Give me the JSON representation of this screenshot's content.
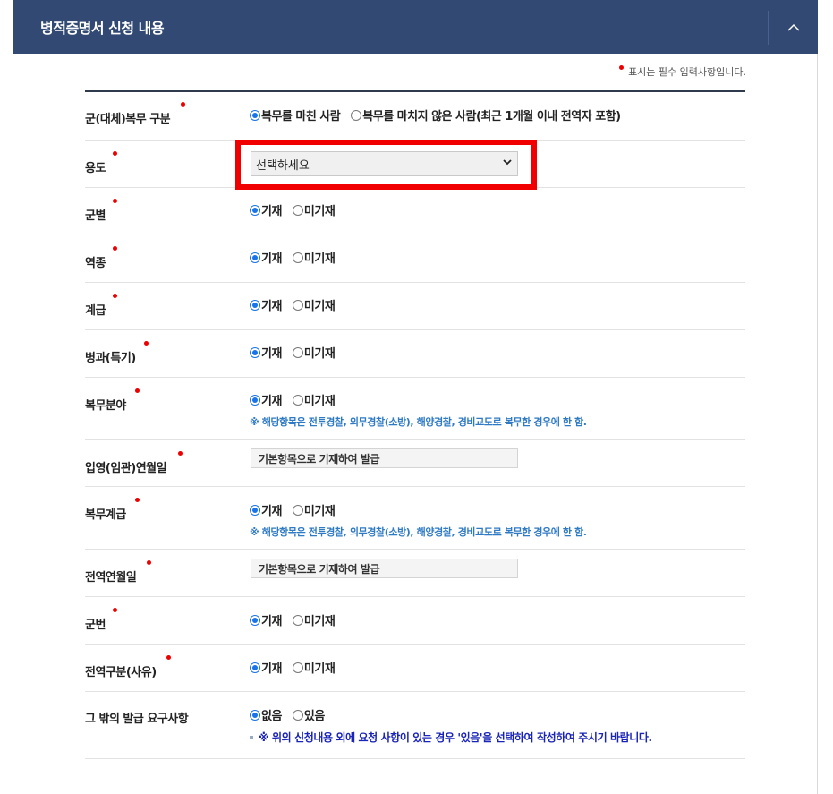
{
  "header": {
    "title": "병적증명서 신청 내용",
    "collapse_icon": "chevron-up-icon"
  },
  "required_note": "표시는 필수 입력사항입니다.",
  "fields": {
    "service_type": {
      "label": "군(대체)복무 구분",
      "options": [
        "복무를 마친 사람",
        "복무를 마치지 않은 사람(최근 1개월 이내 전역자 포함)"
      ],
      "selected": 0
    },
    "purpose": {
      "label": "용도",
      "value": "선택하세요"
    },
    "branch": {
      "label": "군별",
      "options": [
        "기재",
        "미기재"
      ],
      "selected": 0
    },
    "service_category": {
      "label": "역종",
      "options": [
        "기재",
        "미기재"
      ],
      "selected": 0
    },
    "rank": {
      "label": "계급",
      "options": [
        "기재",
        "미기재"
      ],
      "selected": 0
    },
    "specialty": {
      "label": "병과(특기)",
      "options": [
        "기재",
        "미기재"
      ],
      "selected": 0
    },
    "service_field": {
      "label": "복무분야",
      "options": [
        "기재",
        "미기재"
      ],
      "selected": 0,
      "hint": "※ 해당항목은 전투경찰, 의무경찰(소방), 해양경찰, 경비교도로 복무한 경우에 한 함."
    },
    "enlist_date": {
      "label": "입영(임관)연월일",
      "value": "기본항목으로 기재하여 발급"
    },
    "service_rank": {
      "label": "복무계급",
      "options": [
        "기재",
        "미기재"
      ],
      "selected": 0,
      "hint": "※ 해당항목은 전투경찰, 의무경찰(소방), 해양경찰, 경비교도로 복무한 경우에 한 함."
    },
    "discharge_date": {
      "label": "전역연월일",
      "value": "기본항목으로 기재하여 발급"
    },
    "service_number": {
      "label": "군번",
      "options": [
        "기재",
        "미기재"
      ],
      "selected": 0
    },
    "discharge_reason": {
      "label": "전역구분(사유)",
      "options": [
        "기재",
        "미기재"
      ],
      "selected": 0
    },
    "other_requests": {
      "label": "그 밖의 발급 요구사항",
      "options": [
        "없음",
        "있음"
      ],
      "selected": 0,
      "hint": "※ 위의 신청내용 외에 요청 사항이 있는 경우 '있음'을 선택하여 작성하여 주시기 바랍니다."
    }
  },
  "colors": {
    "header_bg": "#324a73",
    "required_dot": "#ee0000",
    "hint_blue": "#2e7ac4",
    "hint_dark_blue": "#1a24b8",
    "highlight": "#f00000"
  }
}
